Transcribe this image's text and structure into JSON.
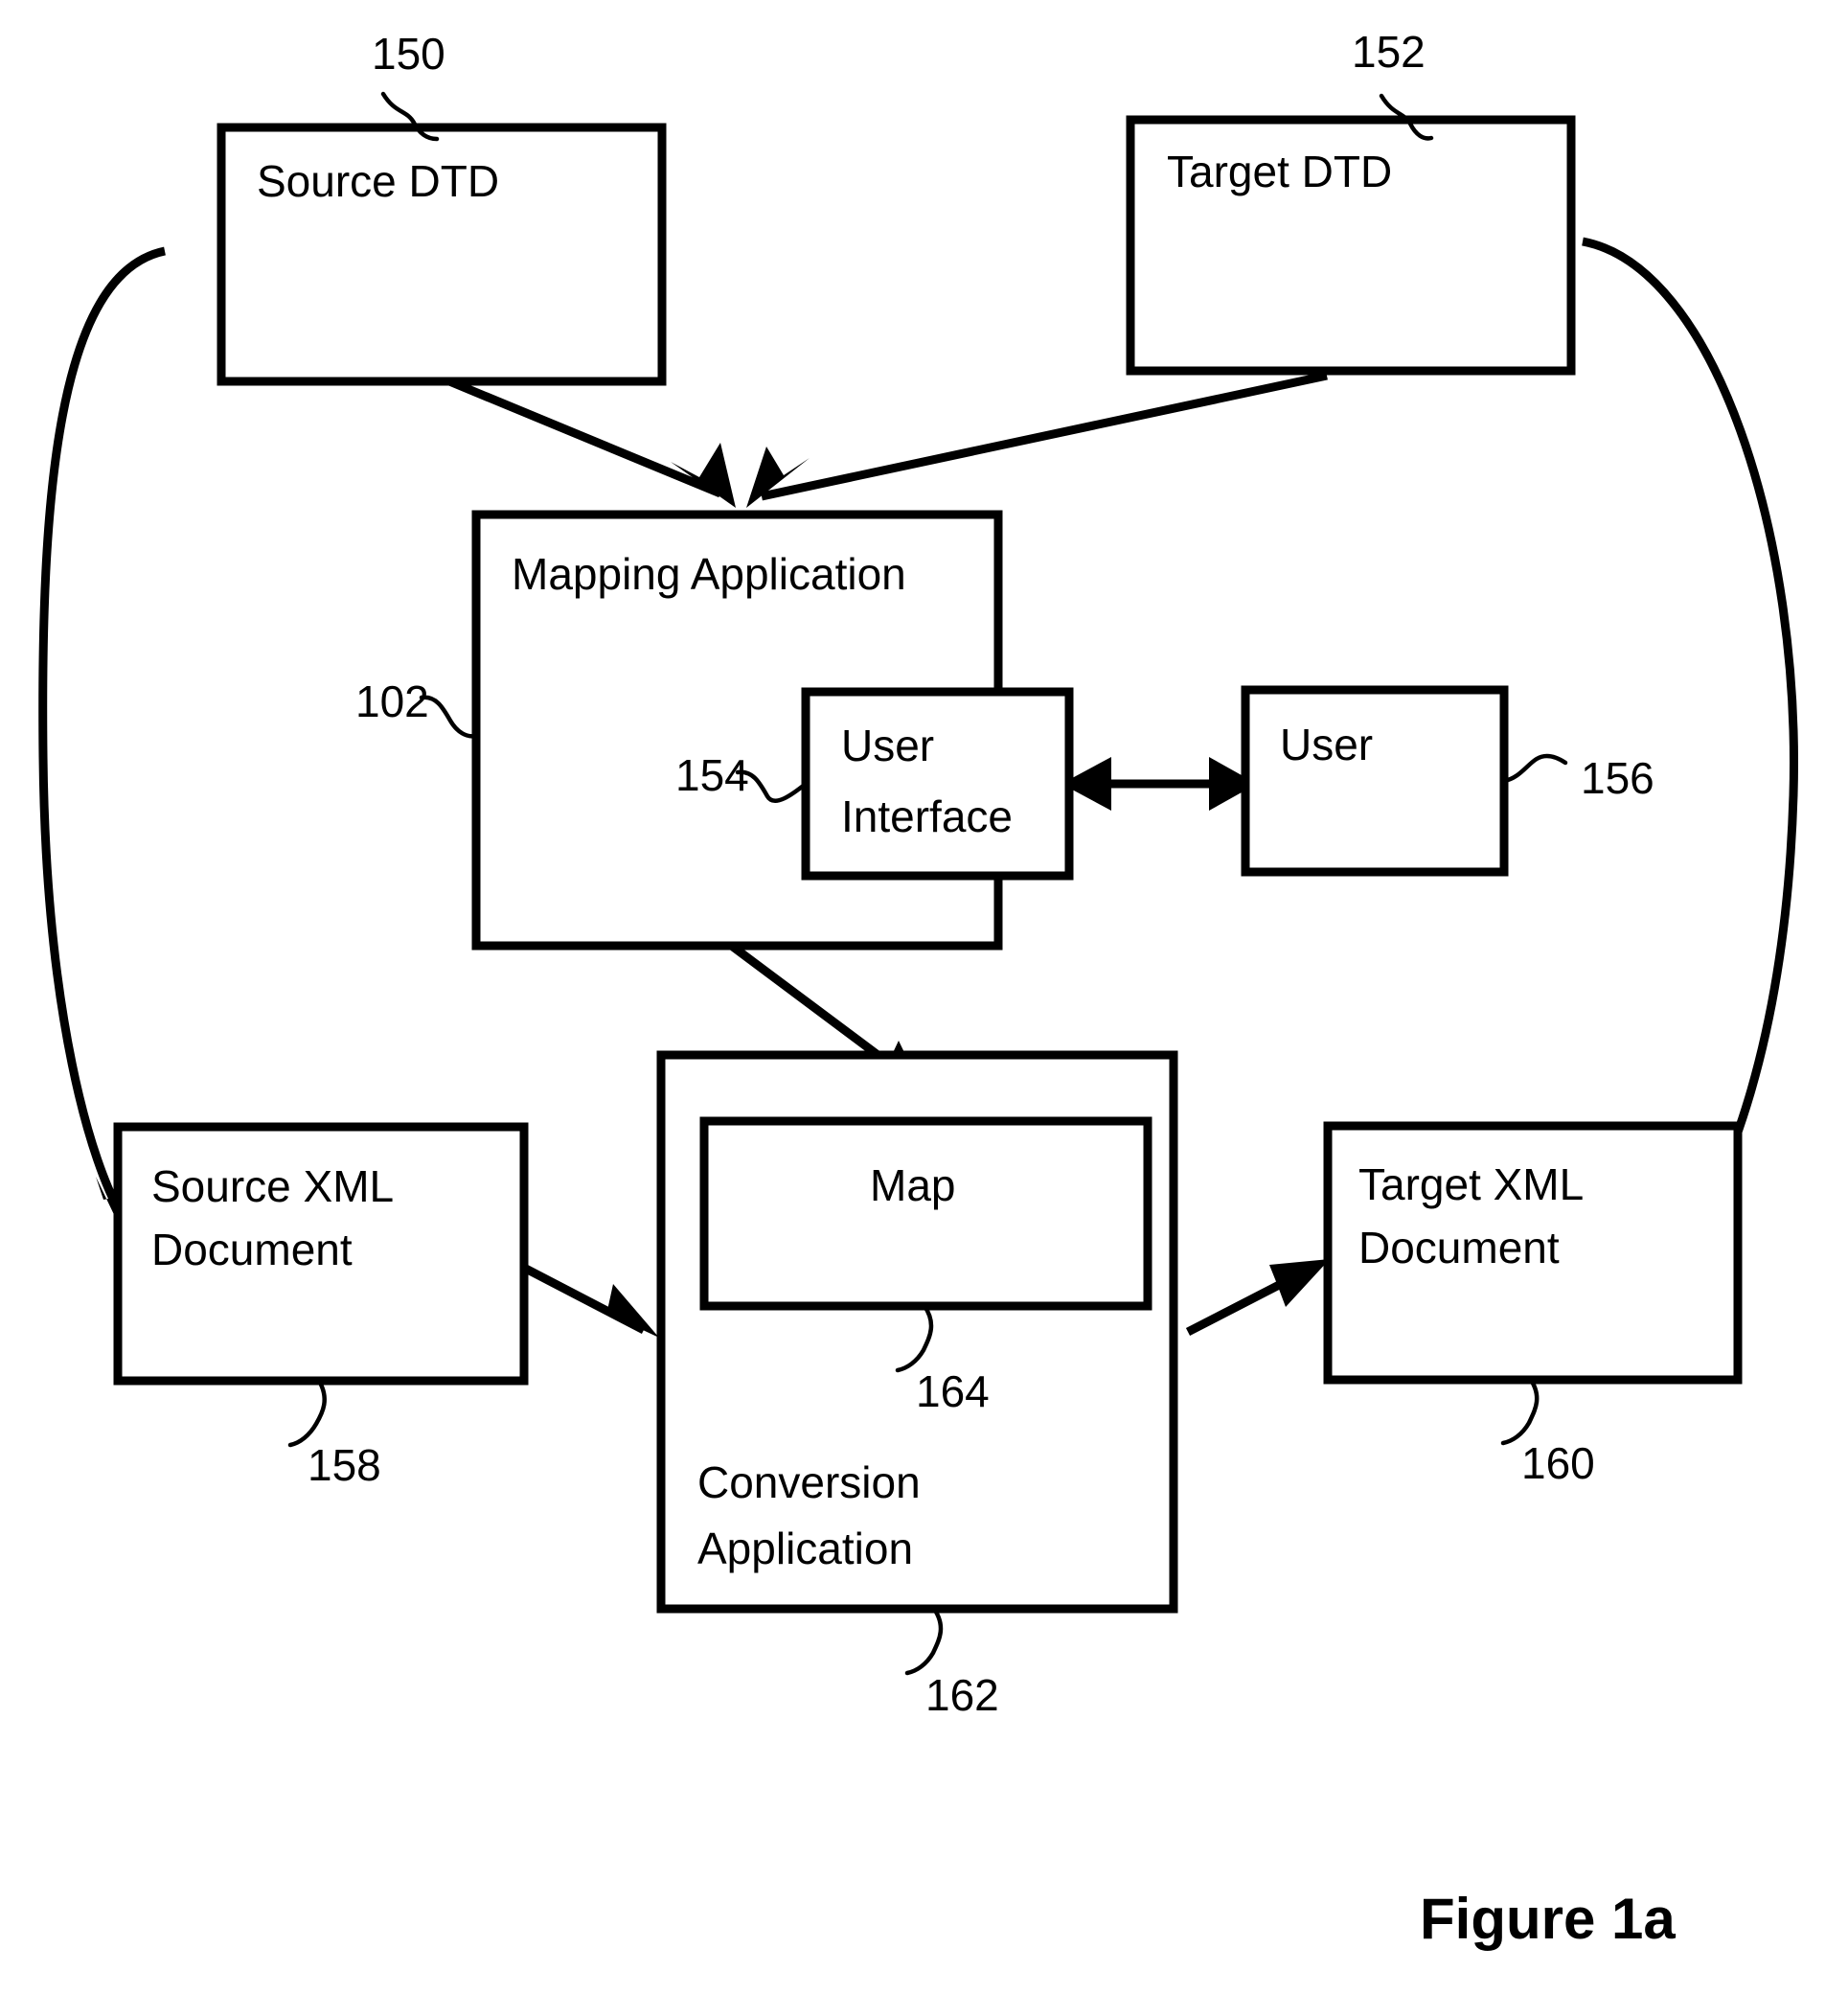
{
  "figure": {
    "caption": "Figure 1a"
  },
  "boxes": {
    "source_dtd": {
      "label": "Source DTD",
      "ref": "150"
    },
    "target_dtd": {
      "label": "Target DTD",
      "ref": "152"
    },
    "mapping_application": {
      "label": "Mapping Application",
      "ref": "102"
    },
    "user_interface": {
      "label_line1": "User",
      "label_line2": "Interface",
      "ref": "154"
    },
    "user": {
      "label": "User",
      "ref": "156"
    },
    "source_xml_document": {
      "label_line1": "Source XML",
      "label_line2": "Document",
      "ref": "158"
    },
    "target_xml_document": {
      "label_line1": "Target XML",
      "label_line2": "Document",
      "ref": "160"
    },
    "conversion_application": {
      "label_line1": "Conversion",
      "label_line2": "Application",
      "ref": "162"
    },
    "map": {
      "label": "Map",
      "ref": "164"
    }
  },
  "colors": {
    "stroke": "#000000",
    "fill": "#ffffff"
  }
}
